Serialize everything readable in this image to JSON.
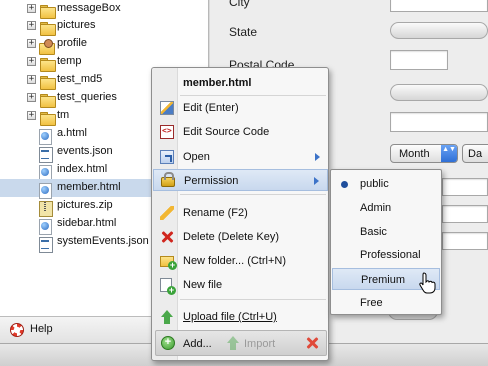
{
  "tree": {
    "items": [
      {
        "label": "messageBox",
        "icon": "folder-icon",
        "expandable": true
      },
      {
        "label": "pictures",
        "icon": "folder-icon",
        "expandable": true
      },
      {
        "label": "profile",
        "icon": "profile-folder-icon",
        "expandable": true
      },
      {
        "label": "temp",
        "icon": "folder-icon",
        "expandable": true
      },
      {
        "label": "test_md5",
        "icon": "folder-icon",
        "expandable": true
      },
      {
        "label": "test_queries",
        "icon": "folder-icon",
        "expandable": true
      },
      {
        "label": "tm",
        "icon": "folder-icon",
        "expandable": true
      },
      {
        "label": "a.html",
        "icon": "html-file-icon",
        "expandable": false
      },
      {
        "label": "events.json",
        "icon": "text-file-icon",
        "expandable": false
      },
      {
        "label": "index.html",
        "icon": "html-file-icon",
        "expandable": false
      },
      {
        "label": "member.html",
        "icon": "html-file-icon",
        "expandable": false,
        "selected": true
      },
      {
        "label": "pictures.zip",
        "icon": "zip-file-icon",
        "expandable": false
      },
      {
        "label": "sidebar.html",
        "icon": "html-file-icon",
        "expandable": false
      },
      {
        "label": "systemEvents.json",
        "icon": "text-file-icon",
        "expandable": false
      }
    ],
    "expander_symbol": "+"
  },
  "help": {
    "label": "Help"
  },
  "form": {
    "labels": {
      "city": "City",
      "state": "State",
      "postal_code": "Postal Code"
    },
    "month_select": {
      "value": "Month",
      "arrows": "▲▼"
    },
    "day_select": {
      "value": "Da"
    }
  },
  "context_menu": {
    "header": "member.html",
    "items": {
      "edit": "Edit (Enter)",
      "edit_source": "Edit Source Code",
      "open": "Open",
      "permission": "Permission",
      "rename": "Rename (F2)",
      "delete": "Delete (Delete Key)",
      "new_folder": "New folder... (Ctrl+N)",
      "new_file": "New file",
      "upload": "Upload file (Ctrl+U)"
    },
    "footer": {
      "add": "Add...",
      "import": "Import"
    }
  },
  "permission_submenu": {
    "options": [
      "public",
      "Admin",
      "Basic",
      "Professional",
      "Premium",
      "Free"
    ],
    "selected": "public",
    "hovered": "Premium"
  },
  "colors": {
    "selection": "#c9d9ec",
    "hover": "#c8d8ee",
    "accent_blue": "#3d73c8",
    "radio": "#1f4f9c"
  }
}
